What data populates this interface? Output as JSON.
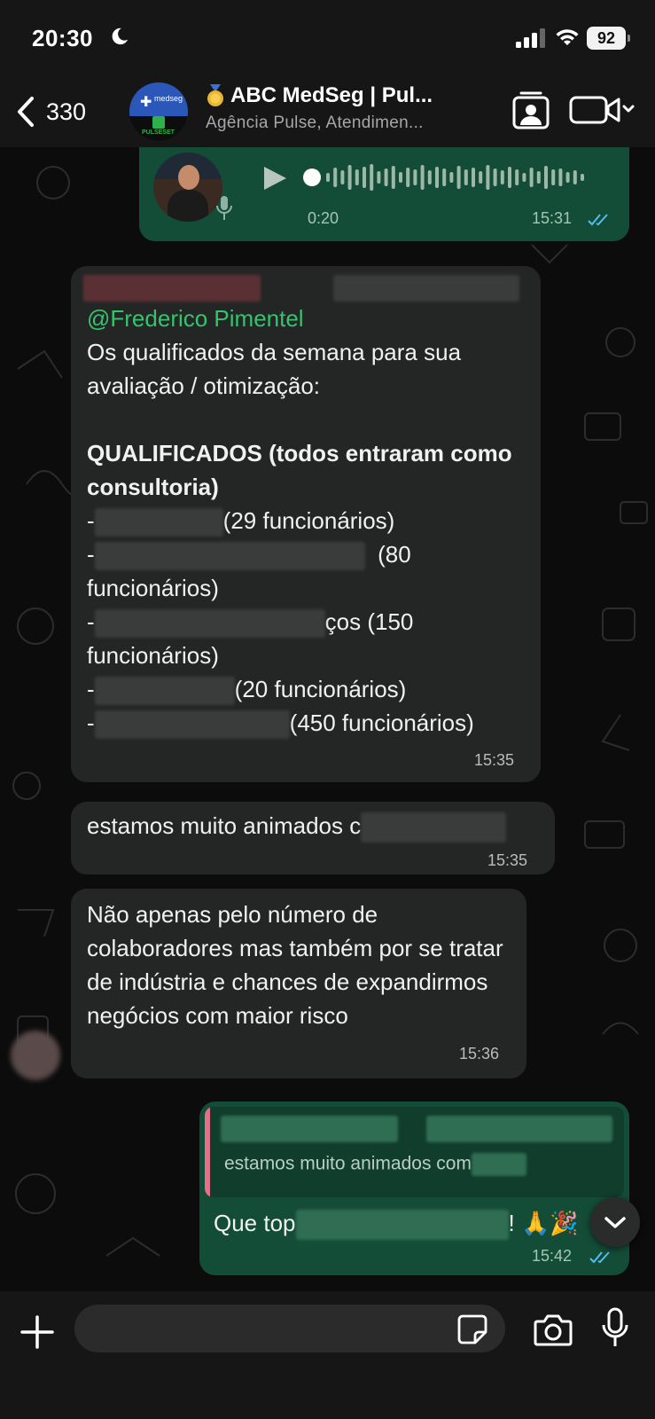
{
  "status": {
    "time": "20:30",
    "battery": "92"
  },
  "header": {
    "back_count": "330",
    "title": "ABC MedSeg | Pul...",
    "subtitle": "Agência Pulse, Atendimen...",
    "avatar_brand": "medseg",
    "avatar_label": "PULSESET"
  },
  "messages": {
    "voice": {
      "duration": "0:20",
      "time": "15:31"
    },
    "qualified": {
      "mention": "@Frederico Pimentel",
      "intro": "Os qualificados da semana para sua avaliação / otimização:",
      "heading": "QUALIFICADOS (todos entraram como consultoria)",
      "item1": "(29 funcionários)",
      "item2": "(80",
      "item2b": "funcionários)",
      "item3": "ços (150",
      "item3b": "funcionários)",
      "item4": "(20 funcionários)",
      "item5": "(450 funcionários)",
      "time": "15:35"
    },
    "excited": {
      "text": "estamos muito animados c",
      "time": "15:35"
    },
    "reason": {
      "text": "Não apenas pelo número de colaboradores mas também por se tratar de indústria e chances de expandirmos negócios com maior risco",
      "time": "15:36"
    },
    "reply": {
      "quoted_text": "estamos muito animados com",
      "text_start": "Que top",
      "text_end": "! 🙏🎉",
      "time": "15:42"
    }
  },
  "colors": {
    "outgoing_bubble": "#144d37",
    "incoming_bubble": "#242626",
    "mention": "#33c46c",
    "read_ticks": "#53bdeb"
  }
}
